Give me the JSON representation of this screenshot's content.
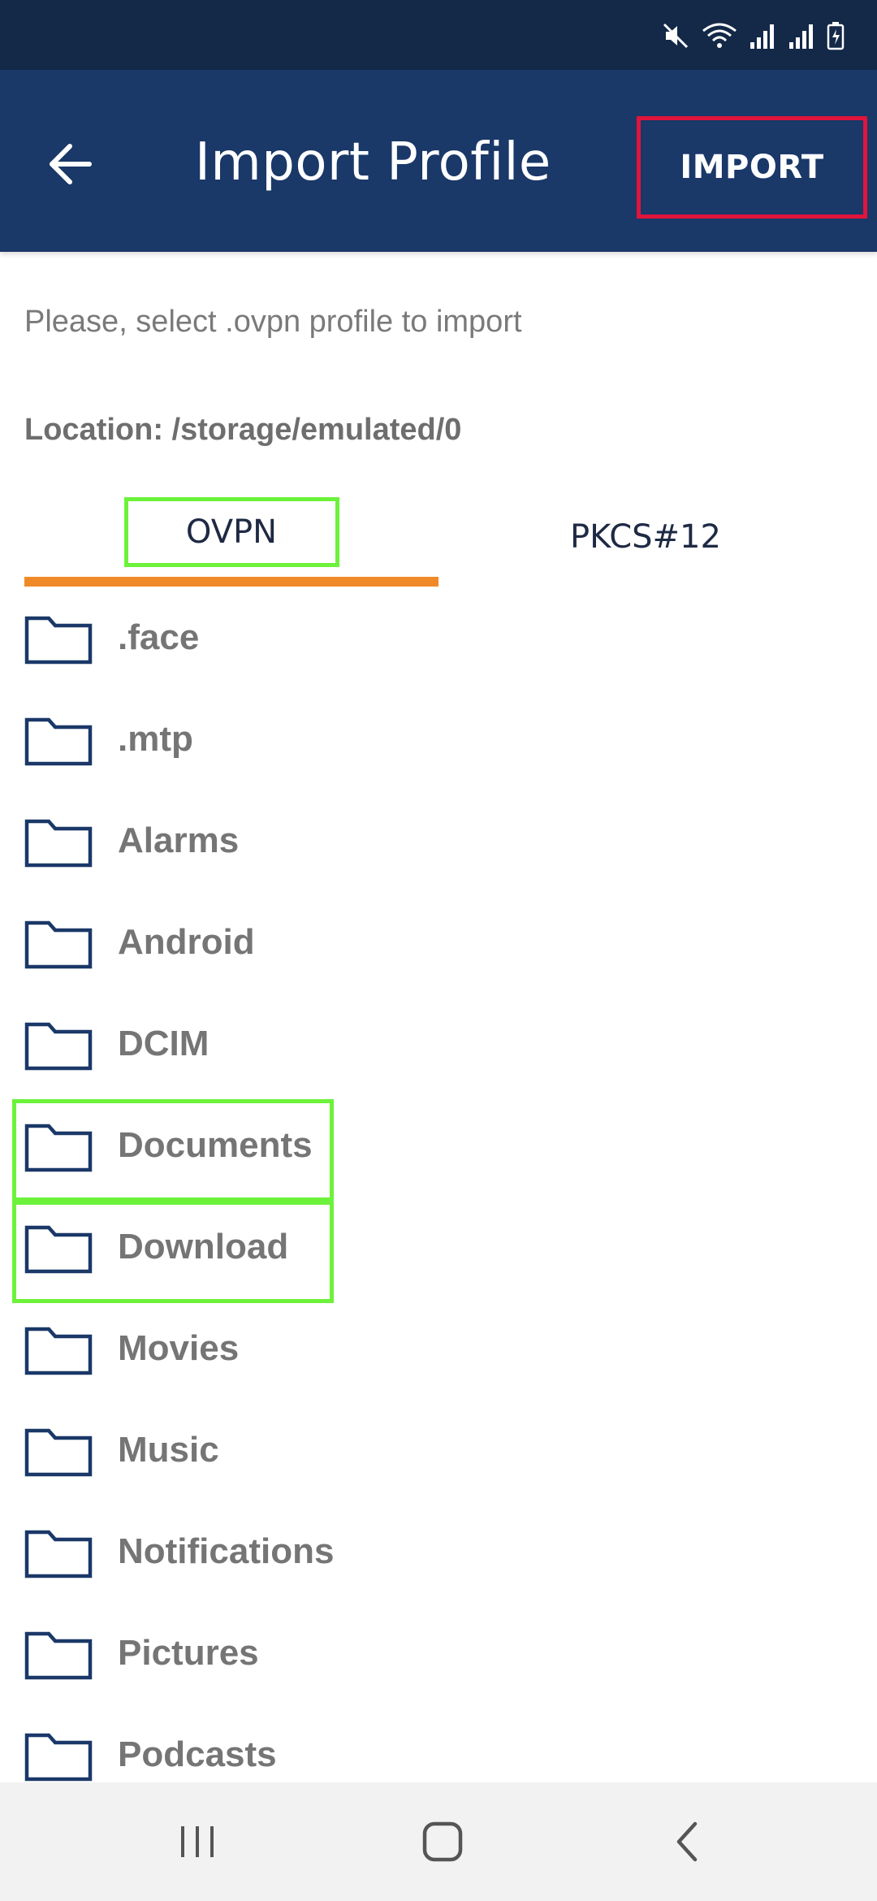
{
  "app_bar": {
    "title": "Import Profile",
    "import_label": "IMPORT"
  },
  "instruction": "Please, select .ovpn profile to import",
  "location": "Location: /storage/emulated/0",
  "tabs": [
    {
      "label": "OVPN",
      "selected": true
    },
    {
      "label": "PKCS#12",
      "selected": false
    }
  ],
  "folders": [
    {
      "label": ".face"
    },
    {
      "label": ".mtp"
    },
    {
      "label": "Alarms"
    },
    {
      "label": "Android"
    },
    {
      "label": "DCIM"
    },
    {
      "label": "Documents"
    },
    {
      "label": "Download"
    },
    {
      "label": "Movies"
    },
    {
      "label": "Music"
    },
    {
      "label": "Notifications"
    },
    {
      "label": "Pictures"
    },
    {
      "label": "Podcasts"
    }
  ],
  "colors": {
    "status_bar": "#142848",
    "app_bar": "#1a3868",
    "tab_indicator": "#f08a28",
    "folder_icon": "#1a3868",
    "highlight_red": "#e0143c",
    "highlight_green": "#6cf23a"
  },
  "icons": {
    "back": "arrow-left-icon",
    "folder": "folder-icon",
    "nav_recents": "recents-icon",
    "nav_home": "home-icon",
    "nav_back": "chevron-left-icon"
  }
}
